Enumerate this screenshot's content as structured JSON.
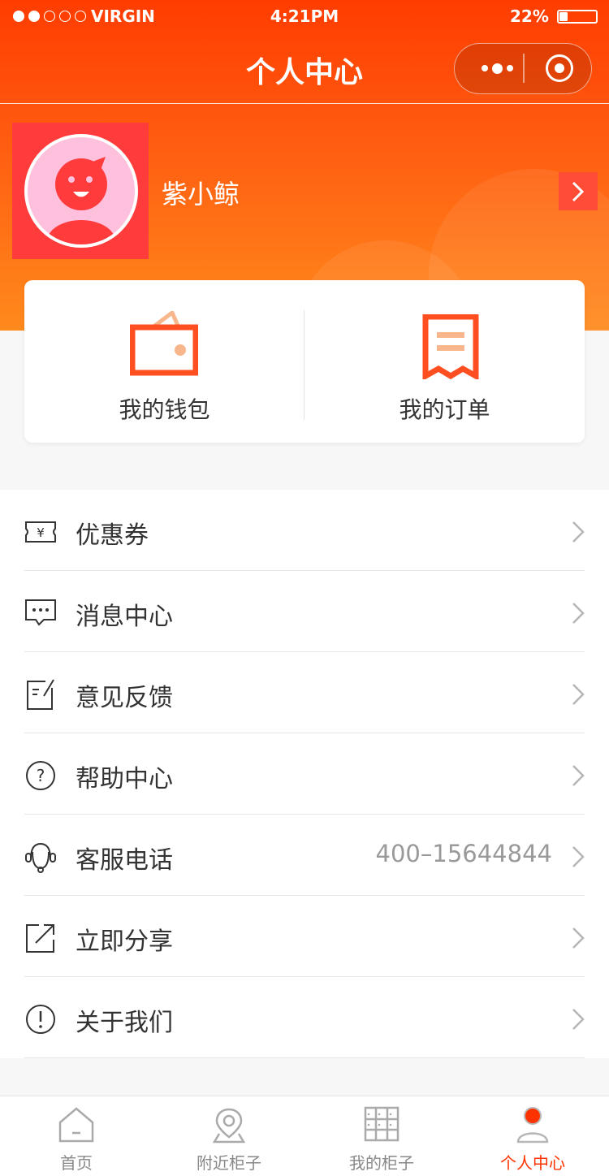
{
  "status_bar": {
    "carrier": "VIRGIN",
    "time": "4:21PM",
    "battery_percent": "22%",
    "battery_level": 0.22,
    "signal_strength": 2,
    "signal_max": 5
  },
  "nav": {
    "title": "个人中心"
  },
  "profile": {
    "username": "紫小鲸"
  },
  "quick_actions": [
    {
      "label": "我的钱包",
      "icon": "wallet-icon"
    },
    {
      "label": "我的订单",
      "icon": "receipt-icon"
    }
  ],
  "menu": [
    {
      "label": "优惠券",
      "icon": "coupon-icon",
      "value": ""
    },
    {
      "label": "消息中心",
      "icon": "message-icon",
      "value": ""
    },
    {
      "label": "意见反馈",
      "icon": "feedback-icon",
      "value": ""
    },
    {
      "label": "帮助中心",
      "icon": "help-icon",
      "value": ""
    },
    {
      "label": "客服电话",
      "icon": "customer-service-icon",
      "value": "400–15644844"
    },
    {
      "label": "立即分享",
      "icon": "share-icon",
      "value": ""
    },
    {
      "label": "关于我们",
      "icon": "info-icon",
      "value": ""
    }
  ],
  "tabbar": [
    {
      "label": "首页",
      "icon": "home-icon",
      "active": false
    },
    {
      "label": "附近柜子",
      "icon": "location-pin-icon",
      "active": false
    },
    {
      "label": "我的柜子",
      "icon": "locker-icon",
      "active": false
    },
    {
      "label": "个人中心",
      "icon": "user-icon",
      "active": true
    }
  ],
  "colors": {
    "brand": "#ff3c00",
    "gradient_end": "#ff8a1c",
    "accent_icon": "#ff4e1f",
    "accent_light": "#f8b68c",
    "active_tab": "#ff3300",
    "avatar_bg": "#ff3b3b",
    "avatar_face": "#ff3b3b",
    "avatar_circle": "#ffc0de"
  }
}
